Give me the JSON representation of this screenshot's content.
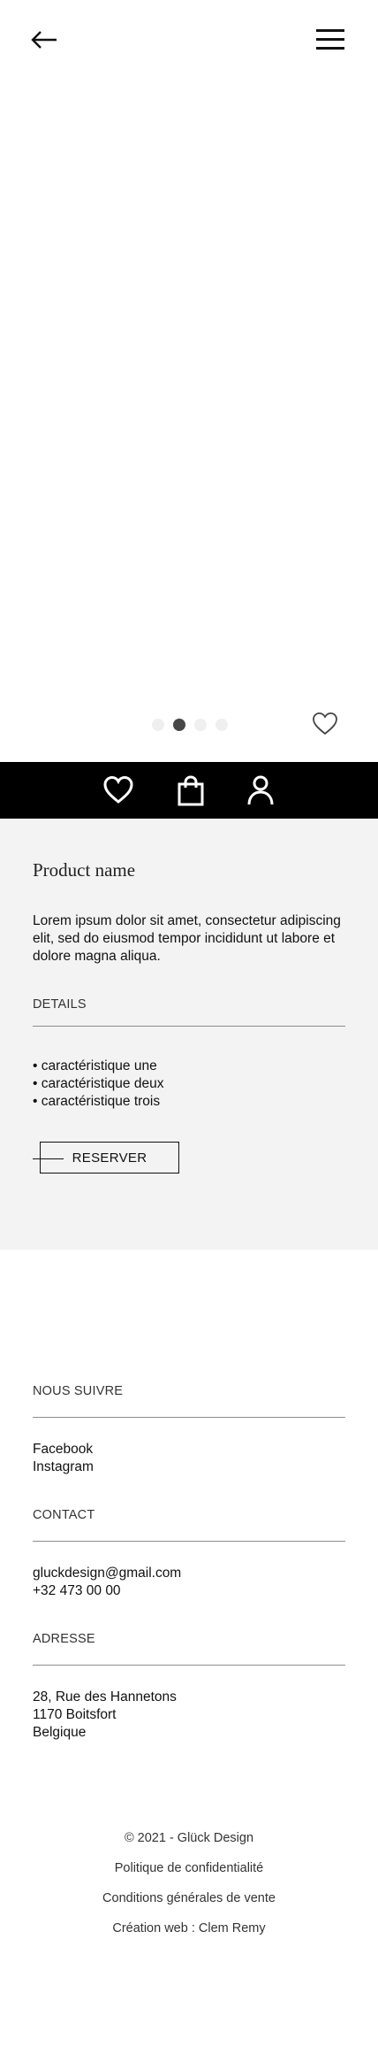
{
  "header": {
    "back_icon": "arrow-left-icon",
    "menu_icon": "hamburger-menu-icon"
  },
  "carousel": {
    "dots": 4,
    "active_index": 1,
    "favorite_icon": "heart-outline-icon"
  },
  "nav": {
    "icons": [
      "heart-icon",
      "shopping-bag-icon",
      "user-icon"
    ],
    "background": "#000000"
  },
  "product": {
    "name": "Product name",
    "description": "Lorem ipsum dolor sit amet, consectetur adipiscing elit, sed do eiusmod tempor incididunt ut labore et dolore magna aliqua.",
    "details_label": "DETAILS",
    "features": [
      "• caractéristique une",
      "• caractéristique deux",
      "• caractéristique trois"
    ],
    "reserve_label": "RESERVER",
    "background": "#f3f3f3"
  },
  "footer": {
    "follow_label": "NOUS SUIVRE",
    "social": [
      "Facebook",
      "Instagram"
    ],
    "contact_label": "CONTACT",
    "email": "gluckdesign@gmail.com",
    "phone": "+32 473 00 00",
    "address_label": "ADRESSE",
    "address": [
      "28, Rue des Hannetons",
      "1170 Boitsfort",
      "Belgique"
    ],
    "copyright": "© 2021 - Glück Design",
    "privacy": "Politique de confidentialité",
    "terms": "Conditions générales de vente",
    "credit": "Création web : Clem Remy"
  }
}
